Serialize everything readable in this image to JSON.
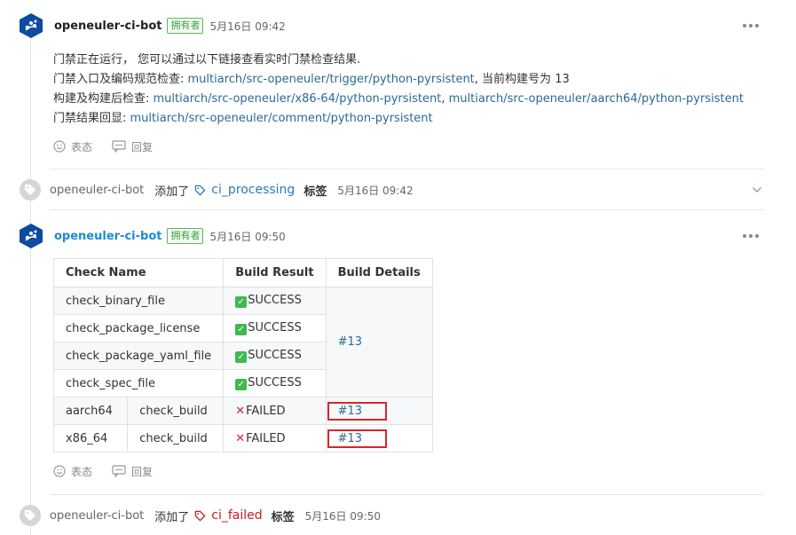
{
  "comment1": {
    "author": "openeuler-ci-bot",
    "badge": "拥有者",
    "time": "5月16日 09:42",
    "line1": "门禁正在运行， 您可以通过以下链接查看实时门禁检查结果.",
    "line2_prefix": "门禁入口及编码规范检查: ",
    "line2_link": "multiarch/src-openeuler/trigger/python-pyrsistent",
    "line2_suffix": ", 当前构建号为 13",
    "line3_prefix": "构建及构建后检查: ",
    "line3_link1": "multiarch/src-openeuler/x86-64/python-pyrsistent",
    "line3_sep": ", ",
    "line3_link2": "multiarch/src-openeuler/aarch64/python-pyrsistent",
    "line4_prefix": "门禁结果回显: ",
    "line4_link": "multiarch/src-openeuler/comment/python-pyrsistent",
    "react_label": "表态",
    "reply_label": "回复"
  },
  "event1": {
    "author": "openeuler-ci-bot",
    "action": "添加了",
    "label": "ci_processing",
    "word": "标签",
    "time": "5月16日 09:42",
    "label_color": "#2a7bbd"
  },
  "comment2": {
    "author": "openeuler-ci-bot",
    "badge": "拥有者",
    "time": "5月16日 09:50",
    "table": {
      "headers": [
        "Check Name",
        "Build Result",
        "Build Details"
      ],
      "rows": [
        {
          "name": "check_binary_file",
          "result": "SUCCESS"
        },
        {
          "name": "check_package_license",
          "result": "SUCCESS"
        },
        {
          "name": "check_package_yaml_file",
          "result": "SUCCESS"
        },
        {
          "name": "check_spec_file",
          "result": "SUCCESS"
        }
      ],
      "merged_detail": "#13",
      "arch_rows": [
        {
          "arch": "aarch64",
          "name": "check_build",
          "result": "FAILED",
          "detail": "#13"
        },
        {
          "arch": "x86_64",
          "name": "check_build",
          "result": "FAILED",
          "detail": "#13"
        }
      ]
    },
    "react_label": "表态",
    "reply_label": "回复"
  },
  "event2": {
    "author": "openeuler-ci-bot",
    "action": "添加了",
    "label": "ci_failed",
    "word": "标签",
    "time": "5月16日 09:50",
    "label_color": "#c71c22"
  },
  "icons": {
    "avatar": "openeuler-logo-icon",
    "more": "more-horizontal-icon",
    "react": "smile-icon",
    "reply": "comment-icon",
    "event": "tag-icon",
    "collapse": "chevron-down-icon"
  }
}
